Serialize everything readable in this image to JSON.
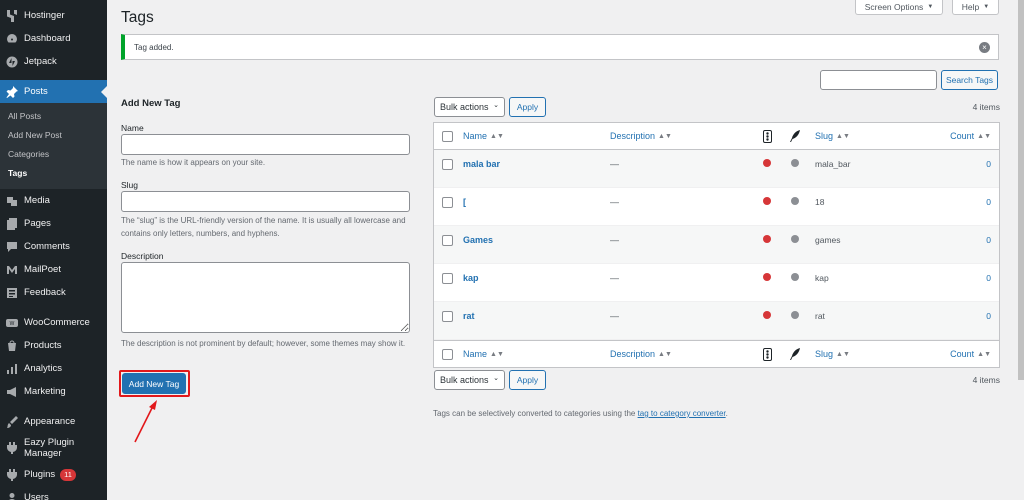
{
  "sidebar": {
    "items": [
      {
        "id": "hostinger",
        "label": "Hostinger",
        "icon": "hostinger-icon"
      },
      {
        "id": "dashboard",
        "label": "Dashboard",
        "icon": "dashboard-icon"
      },
      {
        "id": "jetpack",
        "label": "Jetpack",
        "icon": "jetpack-icon"
      },
      {
        "id": "posts",
        "label": "Posts",
        "icon": "pin-icon",
        "current": true
      },
      {
        "id": "media",
        "label": "Media",
        "icon": "media-icon"
      },
      {
        "id": "pages",
        "label": "Pages",
        "icon": "pages-icon"
      },
      {
        "id": "comments",
        "label": "Comments",
        "icon": "comments-icon"
      },
      {
        "id": "mailpoet",
        "label": "MailPoet",
        "icon": "mailpoet-icon"
      },
      {
        "id": "feedback",
        "label": "Feedback",
        "icon": "feedback-icon"
      },
      {
        "id": "woocommerce",
        "label": "WooCommerce",
        "icon": "woocommerce-icon"
      },
      {
        "id": "products",
        "label": "Products",
        "icon": "products-icon"
      },
      {
        "id": "analytics",
        "label": "Analytics",
        "icon": "analytics-icon"
      },
      {
        "id": "marketing",
        "label": "Marketing",
        "icon": "marketing-icon"
      },
      {
        "id": "appearance",
        "label": "Appearance",
        "icon": "appearance-icon"
      },
      {
        "id": "eazy",
        "label": "Eazy Plugin Manager",
        "icon": "plugin-manager-icon"
      },
      {
        "id": "plugins",
        "label": "Plugins",
        "icon": "plugins-icon",
        "badge": "11"
      },
      {
        "id": "users",
        "label": "Users",
        "icon": "users-icon"
      }
    ],
    "posts_submenu": [
      {
        "label": "All Posts",
        "current": false
      },
      {
        "label": "Add New Post",
        "current": false
      },
      {
        "label": "Categories",
        "current": false
      },
      {
        "label": "Tags",
        "current": true
      }
    ]
  },
  "header": {
    "title": "Tags",
    "screen_options": "Screen Options",
    "help": "Help"
  },
  "notice": {
    "message": "Tag added."
  },
  "form": {
    "heading": "Add New Tag",
    "name_label": "Name",
    "name_value": "",
    "name_hint": "The name is how it appears on your site.",
    "slug_label": "Slug",
    "slug_value": "",
    "slug_hint": "The “slug” is the URL-friendly version of the name. It is usually all lowercase and contains only letters, numbers, and hyphens.",
    "description_label": "Description",
    "description_value": "",
    "description_hint": "The description is not prominent by default; however, some themes may show it.",
    "submit_label": "Add New Tag"
  },
  "search": {
    "value": "",
    "button_label": "Search Tags"
  },
  "table": {
    "bulk_actions": "Bulk actions",
    "apply": "Apply",
    "items_count": "4 items",
    "columns": {
      "name": "Name",
      "description": "Description",
      "slug": "Slug",
      "count": "Count"
    },
    "rows": [
      {
        "name": "mala bar",
        "description": "—",
        "slug": "mala_bar",
        "count": "0"
      },
      {
        "name": "[",
        "description": "—",
        "slug": "18",
        "count": "0"
      },
      {
        "name": "Games",
        "description": "—",
        "slug": "games",
        "count": "0"
      },
      {
        "name": "kap",
        "description": "—",
        "slug": "kap",
        "count": "0"
      },
      {
        "name": "rat",
        "description": "—",
        "slug": "rat",
        "count": "0"
      }
    ]
  },
  "footnote": {
    "text": "Tags can be selectively converted to categories using the",
    "link": "tag to category converter",
    "suffix": "."
  },
  "colors": {
    "accent": "#2271b1",
    "sidebar_bg": "#1d2327",
    "notice_success": "#00a32a",
    "status_red": "#d63638",
    "status_grey": "#8c8f94",
    "annotation_red": "#e2181b"
  }
}
